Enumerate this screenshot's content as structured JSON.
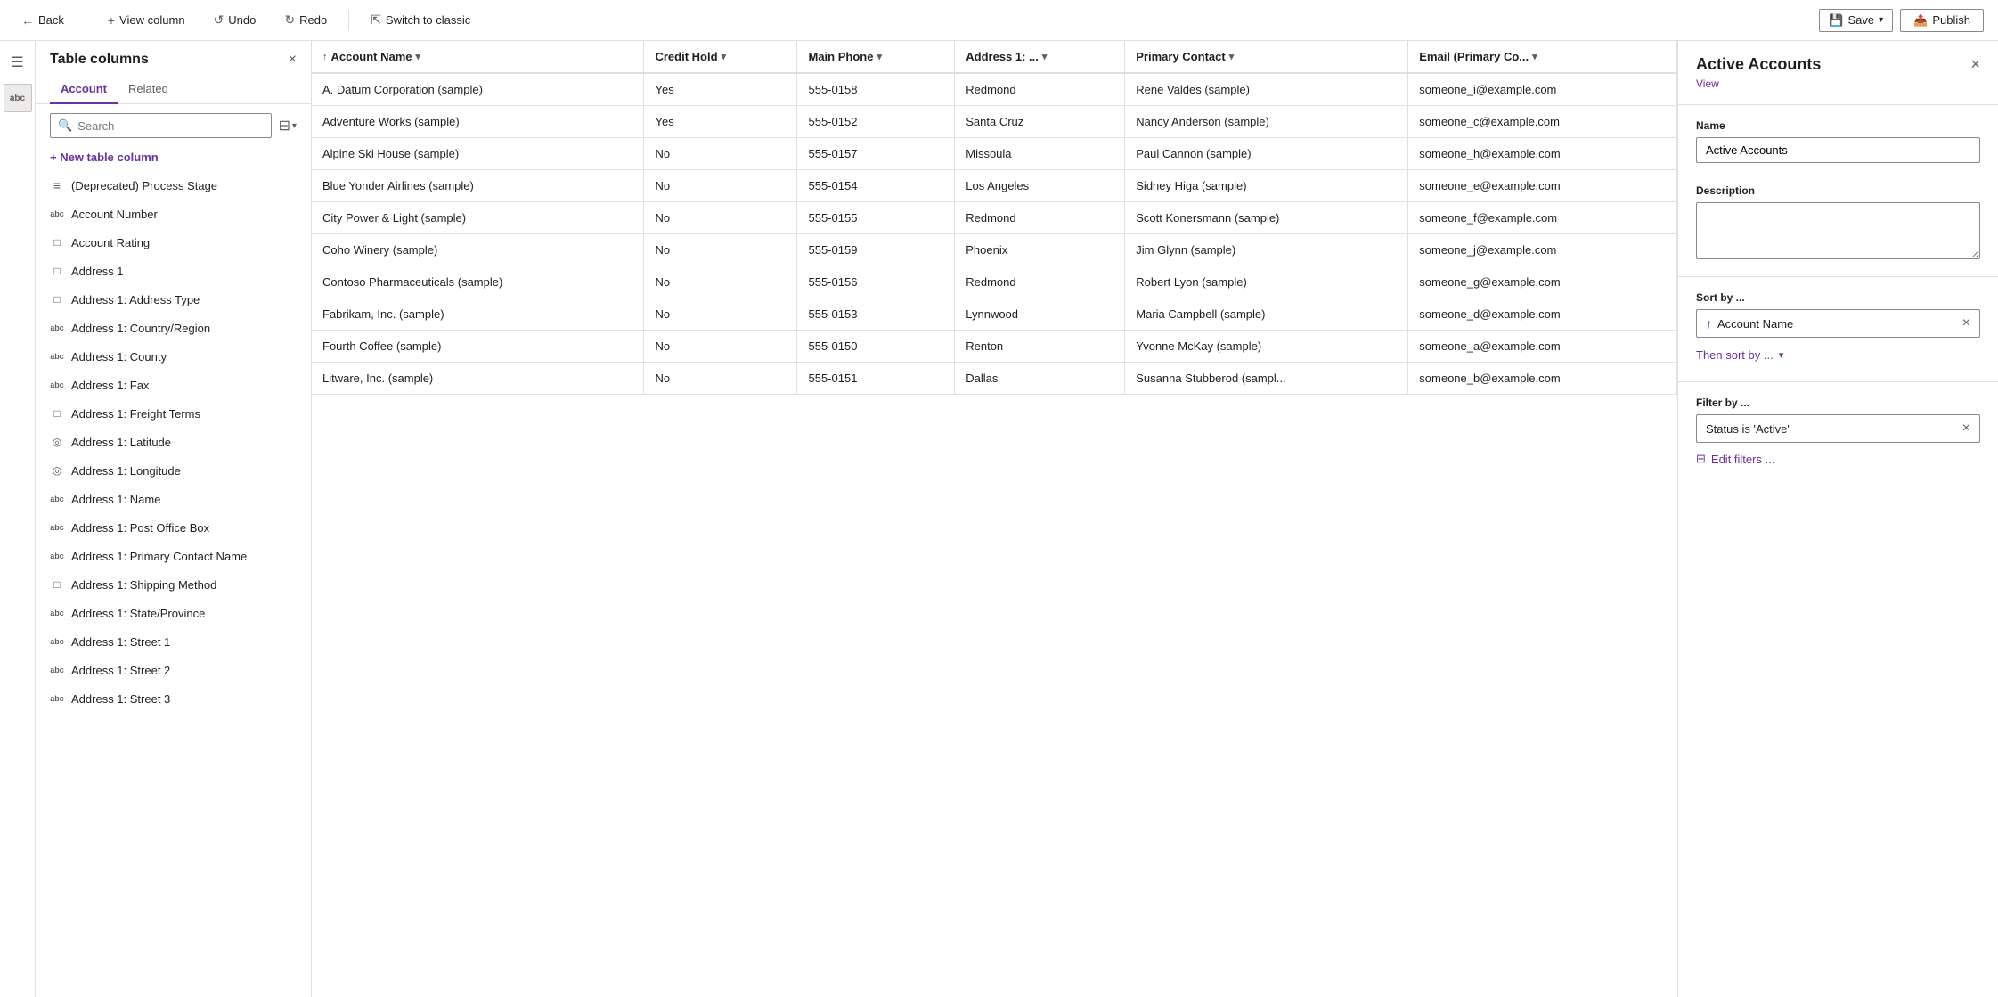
{
  "topbar": {
    "back_label": "Back",
    "view_column_label": "View column",
    "undo_label": "Undo",
    "redo_label": "Redo",
    "switch_label": "Switch to classic",
    "save_label": "Save",
    "publish_label": "Publish"
  },
  "left_panel": {
    "title": "Table columns",
    "close_label": "×",
    "tabs": [
      {
        "id": "account",
        "label": "Account",
        "active": true
      },
      {
        "id": "related",
        "label": "Related",
        "active": false
      }
    ],
    "search_placeholder": "Search",
    "new_column_label": "+ New table column",
    "columns": [
      {
        "id": "deprecated-process-stage",
        "icon": "list",
        "label": "(Deprecated) Process Stage"
      },
      {
        "id": "account-number",
        "icon": "abc",
        "label": "Account Number"
      },
      {
        "id": "account-rating",
        "icon": "box",
        "label": "Account Rating"
      },
      {
        "id": "address-1",
        "icon": "box",
        "label": "Address 1"
      },
      {
        "id": "address-1-address-type",
        "icon": "box",
        "label": "Address 1: Address Type"
      },
      {
        "id": "address-1-country",
        "icon": "abc",
        "label": "Address 1: Country/Region"
      },
      {
        "id": "address-1-county",
        "icon": "abc",
        "label": "Address 1: County"
      },
      {
        "id": "address-1-fax",
        "icon": "abc",
        "label": "Address 1: Fax"
      },
      {
        "id": "address-1-freight-terms",
        "icon": "box",
        "label": "Address 1: Freight Terms"
      },
      {
        "id": "address-1-latitude",
        "icon": "circle",
        "label": "Address 1: Latitude"
      },
      {
        "id": "address-1-longitude",
        "icon": "circle",
        "label": "Address 1: Longitude"
      },
      {
        "id": "address-1-name",
        "icon": "abc",
        "label": "Address 1: Name"
      },
      {
        "id": "address-1-po-box",
        "icon": "abc",
        "label": "Address 1: Post Office Box"
      },
      {
        "id": "address-1-primary-contact",
        "icon": "abc",
        "label": "Address 1: Primary Contact Name"
      },
      {
        "id": "address-1-shipping-method",
        "icon": "box",
        "label": "Address 1: Shipping Method"
      },
      {
        "id": "address-1-state",
        "icon": "abc",
        "label": "Address 1: State/Province"
      },
      {
        "id": "address-1-street-1",
        "icon": "abc",
        "label": "Address 1: Street 1"
      },
      {
        "id": "address-1-street-2",
        "icon": "abc",
        "label": "Address 1: Street 2"
      },
      {
        "id": "address-1-street-3",
        "icon": "abc",
        "label": "Address 1: Street 3"
      }
    ]
  },
  "table": {
    "columns": [
      {
        "id": "account-name",
        "label": "Account Name",
        "sort": "asc",
        "has_chevron": true
      },
      {
        "id": "credit-hold",
        "label": "Credit Hold",
        "has_chevron": true
      },
      {
        "id": "main-phone",
        "label": "Main Phone",
        "has_chevron": true
      },
      {
        "id": "address",
        "label": "Address 1: ...",
        "has_chevron": true
      },
      {
        "id": "primary-contact",
        "label": "Primary Contact",
        "has_chevron": true
      },
      {
        "id": "email",
        "label": "Email (Primary Co...",
        "has_chevron": true
      }
    ],
    "rows": [
      {
        "account_name": "A. Datum Corporation (sample)",
        "credit_hold": "Yes",
        "main_phone": "555-0158",
        "address": "Redmond",
        "primary_contact": "Rene Valdes (sample)",
        "email": "someone_i@example.com"
      },
      {
        "account_name": "Adventure Works (sample)",
        "credit_hold": "Yes",
        "main_phone": "555-0152",
        "address": "Santa Cruz",
        "primary_contact": "Nancy Anderson (sample)",
        "email": "someone_c@example.com"
      },
      {
        "account_name": "Alpine Ski House (sample)",
        "credit_hold": "No",
        "main_phone": "555-0157",
        "address": "Missoula",
        "primary_contact": "Paul Cannon (sample)",
        "email": "someone_h@example.com"
      },
      {
        "account_name": "Blue Yonder Airlines (sample)",
        "credit_hold": "No",
        "main_phone": "555-0154",
        "address": "Los Angeles",
        "primary_contact": "Sidney Higa (sample)",
        "email": "someone_e@example.com"
      },
      {
        "account_name": "City Power & Light (sample)",
        "credit_hold": "No",
        "main_phone": "555-0155",
        "address": "Redmond",
        "primary_contact": "Scott Konersmann (sample)",
        "email": "someone_f@example.com"
      },
      {
        "account_name": "Coho Winery (sample)",
        "credit_hold": "No",
        "main_phone": "555-0159",
        "address": "Phoenix",
        "primary_contact": "Jim Glynn (sample)",
        "email": "someone_j@example.com"
      },
      {
        "account_name": "Contoso Pharmaceuticals (sample)",
        "credit_hold": "No",
        "main_phone": "555-0156",
        "address": "Redmond",
        "primary_contact": "Robert Lyon (sample)",
        "email": "someone_g@example.com"
      },
      {
        "account_name": "Fabrikam, Inc. (sample)",
        "credit_hold": "No",
        "main_phone": "555-0153",
        "address": "Lynnwood",
        "primary_contact": "Maria Campbell (sample)",
        "email": "someone_d@example.com"
      },
      {
        "account_name": "Fourth Coffee (sample)",
        "credit_hold": "No",
        "main_phone": "555-0150",
        "address": "Renton",
        "primary_contact": "Yvonne McKay (sample)",
        "email": "someone_a@example.com"
      },
      {
        "account_name": "Litware, Inc. (sample)",
        "credit_hold": "No",
        "main_phone": "555-0151",
        "address": "Dallas",
        "primary_contact": "Susanna Stubberod (sampl...",
        "email": "someone_b@example.com"
      }
    ]
  },
  "right_panel": {
    "title": "Active Accounts",
    "view_label": "View",
    "close_label": "×",
    "name_label": "Name",
    "name_value": "Active Accounts",
    "description_label": "Description",
    "description_placeholder": "",
    "sort_by_label": "Sort by ...",
    "sort_column": "Account Name",
    "then_sort_label": "Then sort by ...",
    "filter_by_label": "Filter by ...",
    "filter_value": "Status is 'Active'",
    "edit_filters_label": "Edit filters ..."
  }
}
